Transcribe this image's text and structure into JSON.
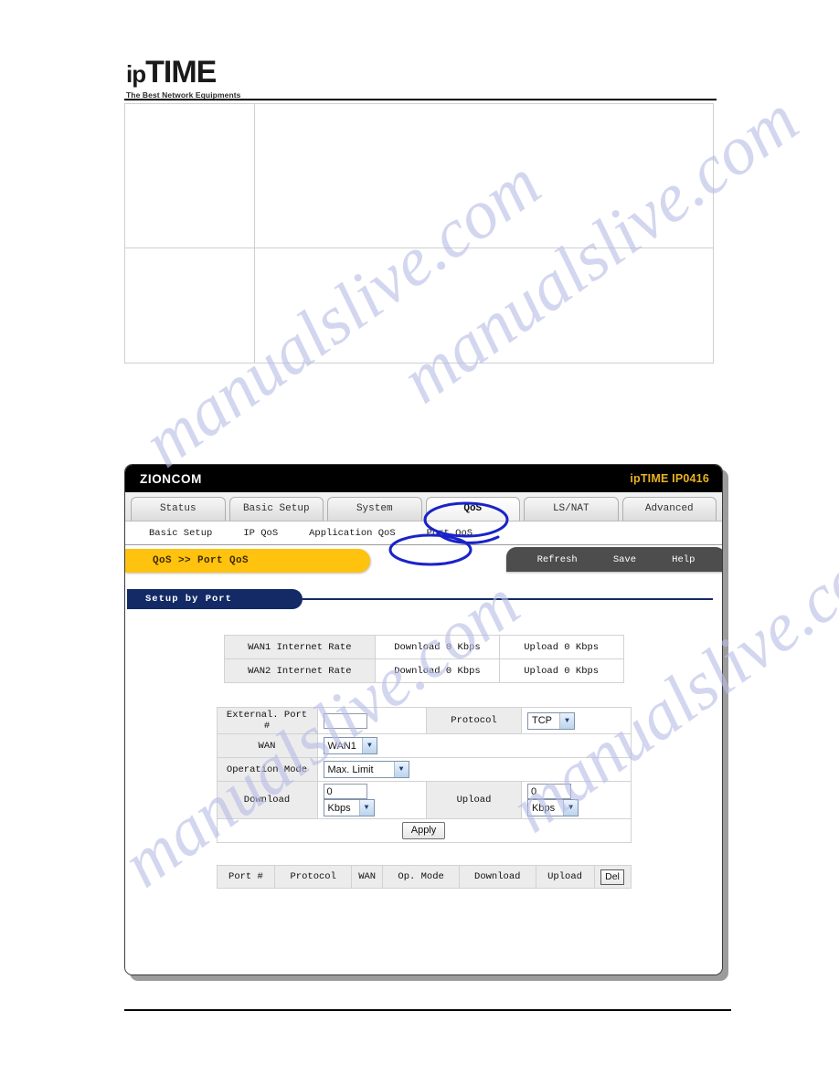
{
  "document": {
    "logo": {
      "prefix": "ip",
      "word": "TIME",
      "tagline": "The Best Network Equipments"
    }
  },
  "router": {
    "titlebar": {
      "vendor": "ZIONCOM",
      "model": "ipTIME IP0416"
    },
    "tabs": [
      {
        "label": "Status",
        "active": false
      },
      {
        "label": "Basic Setup",
        "active": false
      },
      {
        "label": "System",
        "active": false
      },
      {
        "label": "QoS",
        "active": true
      },
      {
        "label": "LS/NAT",
        "active": false
      },
      {
        "label": "Advanced",
        "active": false
      }
    ],
    "subnav": [
      {
        "label": "Basic Setup"
      },
      {
        "label": "IP QoS"
      },
      {
        "label": "Application QoS"
      },
      {
        "label": "Port QoS"
      }
    ],
    "breadcrumb": "QoS >> Port QoS",
    "actions": [
      {
        "label": "Refresh"
      },
      {
        "label": "Save"
      },
      {
        "label": "Help"
      }
    ],
    "section": {
      "title": "Setup by Port"
    },
    "rate_table": {
      "rows": [
        {
          "label": "WAN1 Internet Rate",
          "download": "Download 0 Kbps",
          "upload": "Upload 0 Kbps"
        },
        {
          "label": "WAN2 Internet Rate",
          "download": "Download 0 Kbps",
          "upload": "Upload 0 Kbps"
        }
      ]
    },
    "form": {
      "external_port_label": "External. Port #",
      "external_port_value": "",
      "protocol_label": "Protocol",
      "protocol_value": "TCP",
      "wan_label": "WAN",
      "wan_value": "WAN1",
      "operation_mode_label": "Operation Mode",
      "operation_mode_value": "Max. Limit",
      "download_label": "Download",
      "download_value": "0",
      "download_unit": "Kbps",
      "upload_label": "Upload",
      "upload_value": "0",
      "upload_unit": "Kbps",
      "apply_label": "Apply"
    },
    "list_table": {
      "headers": [
        "Port #",
        "Protocol",
        "WAN",
        "Op. Mode",
        "Download",
        "Upload"
      ],
      "delete_label": "Del",
      "rows": []
    }
  },
  "watermark": {
    "text": "manualslive.com"
  },
  "colors": {
    "titlebar_bg": "#000000",
    "model_text": "#e8b221",
    "breadcrumb_bg": "#ffc20e",
    "actionbar_bg": "#4d4d4d",
    "section_bg": "#132a66",
    "annotation": "#1a23c8"
  }
}
